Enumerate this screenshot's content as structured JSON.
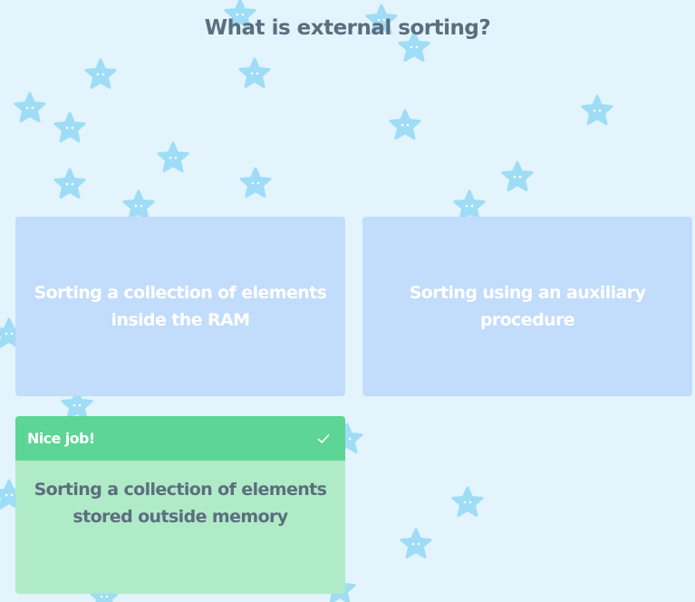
{
  "question": {
    "text": "What is external sorting?"
  },
  "answers": [
    {
      "label": "Sorting a collection of elements inside the RAM",
      "state": "unselected"
    },
    {
      "label": "Sorting using an auxiliary procedure",
      "state": "unselected"
    },
    {
      "label": "Sorting a collection of elements stored outside memory",
      "state": "correct",
      "feedback": "Nice job!"
    }
  ],
  "colors": {
    "background": "#e3f4fd",
    "star": "#9fdcf6",
    "unselected_card": "#c2dcfb",
    "correct_card": "#b0ebc8",
    "correct_bar": "#5cd595",
    "question_text": "#5b6e7e"
  },
  "icons": {
    "decoration": "star-icon",
    "feedback": "check-icon"
  }
}
